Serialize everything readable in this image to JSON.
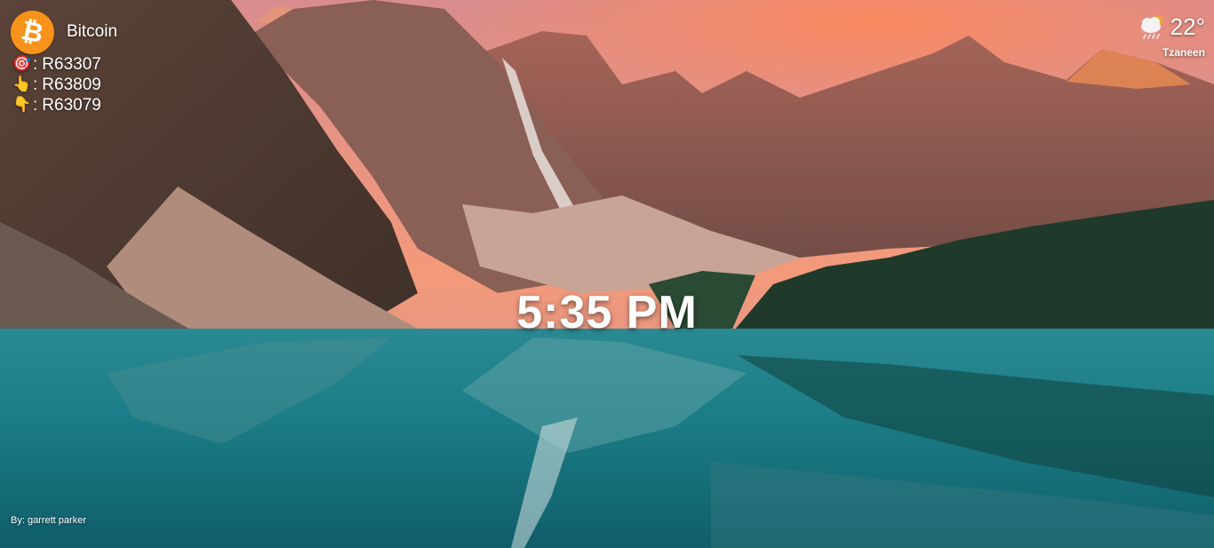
{
  "crypto": {
    "name": "Bitcoin",
    "logo_symbol": "₿",
    "logo_color": "#f7931a",
    "prices": [
      {
        "icon": "target-icon",
        "glyph": "🎯",
        "label": ":",
        "value": "R63307"
      },
      {
        "icon": "pointing-up-icon",
        "glyph": "👆",
        "label": ":",
        "value": "R63809"
      },
      {
        "icon": "pointing-down-icon",
        "glyph": "👇",
        "label": ":",
        "value": "R63079"
      }
    ]
  },
  "weather": {
    "icon": "cloud-rain-sun-icon",
    "temperature": "22°",
    "city": "Tzaneen"
  },
  "clock": {
    "time": "5:35 PM"
  },
  "background": {
    "credit": "By: garrett parker"
  }
}
